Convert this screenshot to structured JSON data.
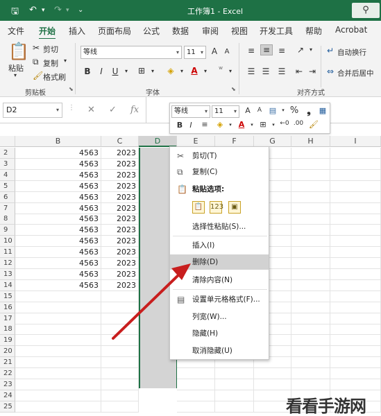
{
  "title_bar": {
    "title": "工作簿1 - Excel",
    "save_icon": "save-icon",
    "undo_icon": "undo-icon",
    "redo_icon": "redo-icon",
    "search_icon": "search-icon"
  },
  "tabs": [
    "文件",
    "开始",
    "插入",
    "页面布局",
    "公式",
    "数据",
    "审阅",
    "视图",
    "开发工具",
    "帮助",
    "Acrobat"
  ],
  "active_tab": "开始",
  "ribbon": {
    "clipboard": {
      "paste": "粘贴",
      "cut": "剪切",
      "copy": "复制",
      "format_painter": "格式刷",
      "group_label": "剪贴板"
    },
    "font": {
      "font_name": "等线",
      "font_size": "11",
      "bold": "B",
      "italic": "I",
      "underline": "U",
      "grow": "A",
      "shrink": "A",
      "group_label": "字体"
    },
    "alignment": {
      "wrap_text": "自动换行",
      "merge_center": "合并后居中",
      "group_label": "对齐方式"
    }
  },
  "formula_bar": {
    "name_box": "D2",
    "cancel": "✕",
    "enter": "✓",
    "fx": "fx"
  },
  "columns": [
    "B",
    "C",
    "D",
    "E",
    "F",
    "G",
    "H",
    "I"
  ],
  "selected_column": "D",
  "rows": [
    {
      "n": "2",
      "b": "4563",
      "c": "2023"
    },
    {
      "n": "3",
      "b": "4563",
      "c": "2023"
    },
    {
      "n": "4",
      "b": "4563",
      "c": "2023"
    },
    {
      "n": "5",
      "b": "4563",
      "c": "2023"
    },
    {
      "n": "6",
      "b": "4563",
      "c": "2023"
    },
    {
      "n": "7",
      "b": "4563",
      "c": "2023"
    },
    {
      "n": "8",
      "b": "4563",
      "c": "2023"
    },
    {
      "n": "9",
      "b": "4563",
      "c": "2023"
    },
    {
      "n": "10",
      "b": "4563",
      "c": "2023"
    },
    {
      "n": "11",
      "b": "4563",
      "c": "2023"
    },
    {
      "n": "12",
      "b": "4563",
      "c": "2023"
    },
    {
      "n": "13",
      "b": "4563",
      "c": "2023"
    },
    {
      "n": "14",
      "b": "4563",
      "c": "2023"
    },
    {
      "n": "15",
      "b": "",
      "c": ""
    },
    {
      "n": "16",
      "b": "",
      "c": ""
    },
    {
      "n": "17",
      "b": "",
      "c": ""
    },
    {
      "n": "18",
      "b": "",
      "c": ""
    },
    {
      "n": "19",
      "b": "",
      "c": ""
    },
    {
      "n": "20",
      "b": "",
      "c": ""
    },
    {
      "n": "21",
      "b": "",
      "c": ""
    },
    {
      "n": "22",
      "b": "",
      "c": ""
    },
    {
      "n": "23",
      "b": "",
      "c": ""
    },
    {
      "n": "24",
      "b": "",
      "c": ""
    },
    {
      "n": "25",
      "b": "",
      "c": ""
    }
  ],
  "mini_toolbar": {
    "font_name": "等线",
    "font_size": "11",
    "percent": "%",
    "comma": "❟",
    "bold": "B",
    "italic": "I"
  },
  "context_menu": {
    "cut": "剪切(T)",
    "copy": "复制(C)",
    "paste_options": "粘贴选项:",
    "paste_special": "选择性粘贴(S)...",
    "insert": "插入(I)",
    "delete": "删除(D)",
    "clear_contents": "清除内容(N)",
    "format_cells": "设置单元格格式(F)...",
    "column_width": "列宽(W)...",
    "hide": "隐藏(H)",
    "unhide": "取消隐藏(U)",
    "highlighted": "删除(D)"
  },
  "watermark": "看看手游网",
  "colors": {
    "excel_green": "#1e7145",
    "arrow_red": "#c81e1e",
    "selection_gray": "#d4d4d4"
  }
}
